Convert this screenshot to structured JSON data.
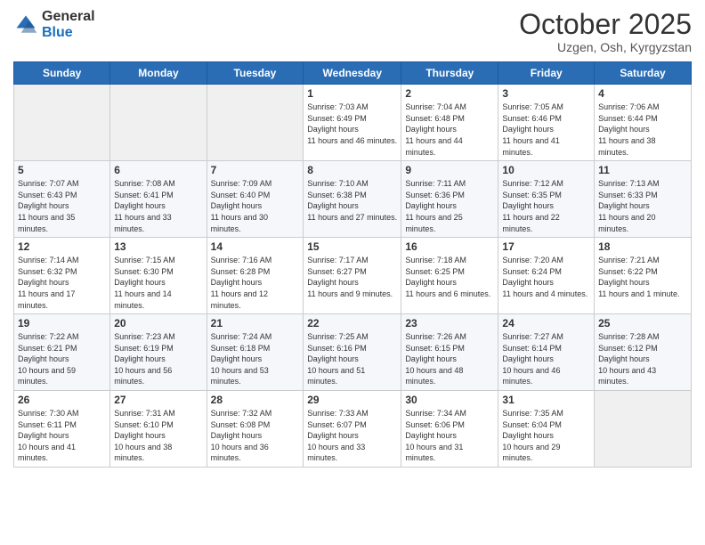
{
  "logo": {
    "general": "General",
    "blue": "Blue"
  },
  "header": {
    "month": "October 2025",
    "location": "Uzgen, Osh, Kyrgyzstan"
  },
  "weekdays": [
    "Sunday",
    "Monday",
    "Tuesday",
    "Wednesday",
    "Thursday",
    "Friday",
    "Saturday"
  ],
  "weeks": [
    [
      {
        "day": "",
        "sunrise": "",
        "sunset": "",
        "daylight": ""
      },
      {
        "day": "",
        "sunrise": "",
        "sunset": "",
        "daylight": ""
      },
      {
        "day": "",
        "sunrise": "",
        "sunset": "",
        "daylight": ""
      },
      {
        "day": "1",
        "sunrise": "7:03 AM",
        "sunset": "6:49 PM",
        "daylight": "11 hours and 46 minutes."
      },
      {
        "day": "2",
        "sunrise": "7:04 AM",
        "sunset": "6:48 PM",
        "daylight": "11 hours and 44 minutes."
      },
      {
        "day": "3",
        "sunrise": "7:05 AM",
        "sunset": "6:46 PM",
        "daylight": "11 hours and 41 minutes."
      },
      {
        "day": "4",
        "sunrise": "7:06 AM",
        "sunset": "6:44 PM",
        "daylight": "11 hours and 38 minutes."
      }
    ],
    [
      {
        "day": "5",
        "sunrise": "7:07 AM",
        "sunset": "6:43 PM",
        "daylight": "11 hours and 35 minutes."
      },
      {
        "day": "6",
        "sunrise": "7:08 AM",
        "sunset": "6:41 PM",
        "daylight": "11 hours and 33 minutes."
      },
      {
        "day": "7",
        "sunrise": "7:09 AM",
        "sunset": "6:40 PM",
        "daylight": "11 hours and 30 minutes."
      },
      {
        "day": "8",
        "sunrise": "7:10 AM",
        "sunset": "6:38 PM",
        "daylight": "11 hours and 27 minutes."
      },
      {
        "day": "9",
        "sunrise": "7:11 AM",
        "sunset": "6:36 PM",
        "daylight": "11 hours and 25 minutes."
      },
      {
        "day": "10",
        "sunrise": "7:12 AM",
        "sunset": "6:35 PM",
        "daylight": "11 hours and 22 minutes."
      },
      {
        "day": "11",
        "sunrise": "7:13 AM",
        "sunset": "6:33 PM",
        "daylight": "11 hours and 20 minutes."
      }
    ],
    [
      {
        "day": "12",
        "sunrise": "7:14 AM",
        "sunset": "6:32 PM",
        "daylight": "11 hours and 17 minutes."
      },
      {
        "day": "13",
        "sunrise": "7:15 AM",
        "sunset": "6:30 PM",
        "daylight": "11 hours and 14 minutes."
      },
      {
        "day": "14",
        "sunrise": "7:16 AM",
        "sunset": "6:28 PM",
        "daylight": "11 hours and 12 minutes."
      },
      {
        "day": "15",
        "sunrise": "7:17 AM",
        "sunset": "6:27 PM",
        "daylight": "11 hours and 9 minutes."
      },
      {
        "day": "16",
        "sunrise": "7:18 AM",
        "sunset": "6:25 PM",
        "daylight": "11 hours and 6 minutes."
      },
      {
        "day": "17",
        "sunrise": "7:20 AM",
        "sunset": "6:24 PM",
        "daylight": "11 hours and 4 minutes."
      },
      {
        "day": "18",
        "sunrise": "7:21 AM",
        "sunset": "6:22 PM",
        "daylight": "11 hours and 1 minute."
      }
    ],
    [
      {
        "day": "19",
        "sunrise": "7:22 AM",
        "sunset": "6:21 PM",
        "daylight": "10 hours and 59 minutes."
      },
      {
        "day": "20",
        "sunrise": "7:23 AM",
        "sunset": "6:19 PM",
        "daylight": "10 hours and 56 minutes."
      },
      {
        "day": "21",
        "sunrise": "7:24 AM",
        "sunset": "6:18 PM",
        "daylight": "10 hours and 53 minutes."
      },
      {
        "day": "22",
        "sunrise": "7:25 AM",
        "sunset": "6:16 PM",
        "daylight": "10 hours and 51 minutes."
      },
      {
        "day": "23",
        "sunrise": "7:26 AM",
        "sunset": "6:15 PM",
        "daylight": "10 hours and 48 minutes."
      },
      {
        "day": "24",
        "sunrise": "7:27 AM",
        "sunset": "6:14 PM",
        "daylight": "10 hours and 46 minutes."
      },
      {
        "day": "25",
        "sunrise": "7:28 AM",
        "sunset": "6:12 PM",
        "daylight": "10 hours and 43 minutes."
      }
    ],
    [
      {
        "day": "26",
        "sunrise": "7:30 AM",
        "sunset": "6:11 PM",
        "daylight": "10 hours and 41 minutes."
      },
      {
        "day": "27",
        "sunrise": "7:31 AM",
        "sunset": "6:10 PM",
        "daylight": "10 hours and 38 minutes."
      },
      {
        "day": "28",
        "sunrise": "7:32 AM",
        "sunset": "6:08 PM",
        "daylight": "10 hours and 36 minutes."
      },
      {
        "day": "29",
        "sunrise": "7:33 AM",
        "sunset": "6:07 PM",
        "daylight": "10 hours and 33 minutes."
      },
      {
        "day": "30",
        "sunrise": "7:34 AM",
        "sunset": "6:06 PM",
        "daylight": "10 hours and 31 minutes."
      },
      {
        "day": "31",
        "sunrise": "7:35 AM",
        "sunset": "6:04 PM",
        "daylight": "10 hours and 29 minutes."
      },
      {
        "day": "",
        "sunrise": "",
        "sunset": "",
        "daylight": ""
      }
    ]
  ]
}
